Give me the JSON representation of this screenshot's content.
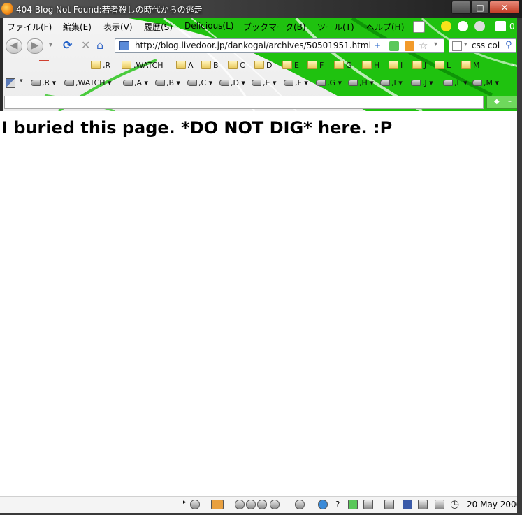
{
  "window": {
    "title": "404 Blog Not Found:若者殺しの時代からの逃走",
    "controls": {
      "minimize": "—",
      "maximize": "□",
      "close": "✕"
    }
  },
  "menu": {
    "items": [
      "ファイル(F)",
      "編集(E)",
      "表示(V)",
      "履歴(S)",
      "Delicious(L)",
      "ブックマーク(B)",
      "ツール(T)",
      "ヘルプ(H)"
    ],
    "mail_count": "0"
  },
  "nav": {
    "url": "http://blog.livedoor.jp/dankogai/archives/50501951.html",
    "search_value": "css col"
  },
  "bookmarks_folders": [
    ",R",
    ",WATCH",
    "A",
    "B",
    "C",
    "D",
    "E",
    "F",
    "G",
    "H",
    "I",
    "J",
    "L",
    "M"
  ],
  "bookmarks_tags": [
    ",R",
    ",WATCH",
    ",A",
    ",B",
    ",C",
    ",D",
    ",E",
    ",F",
    ",G",
    ",H",
    ",I",
    ",J",
    ",L",
    ",M"
  ],
  "page": {
    "heading": "I buried this page. *DO NOT DIG* here. :P"
  },
  "status": {
    "date": "20 May 2006",
    "help_mark": "?"
  },
  "colors": {
    "accent_green": "#1fc20f",
    "titlebar": "#3c3c3c",
    "close_red": "#c23a22"
  }
}
